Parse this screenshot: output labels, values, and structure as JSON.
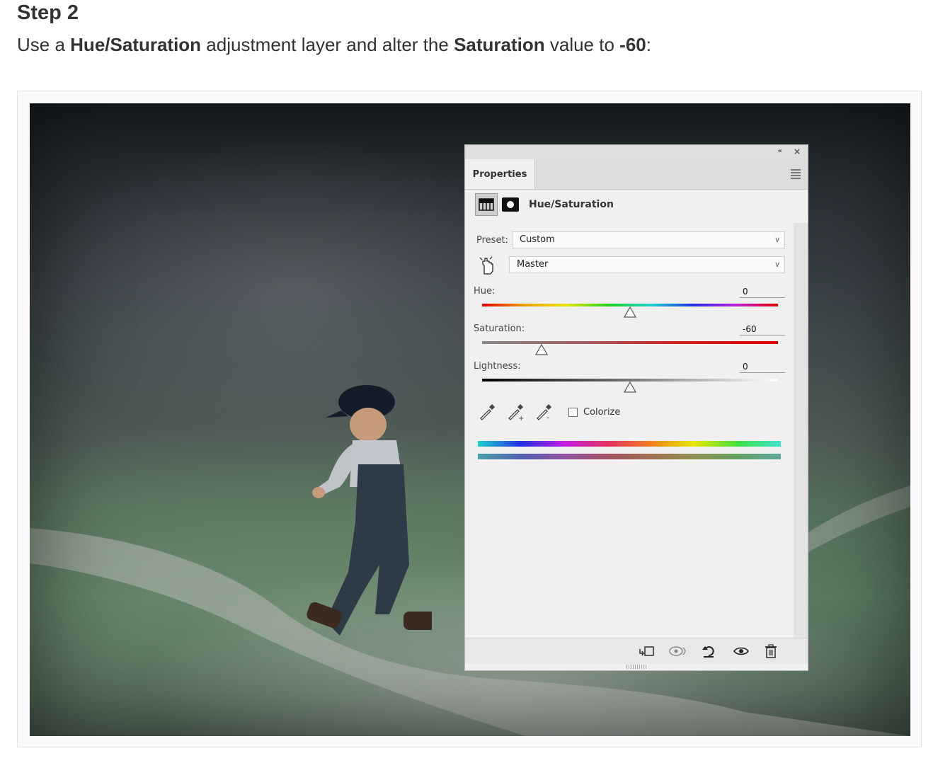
{
  "article": {
    "heading": "Step 2",
    "lead_pre": "Use a ",
    "lead_b1": "Hue/Saturation",
    "lead_mid1": " adjustment layer and alter the ",
    "lead_b2": "Saturation",
    "lead_mid2": " value to ",
    "lead_b3": "-60",
    "lead_end": ":"
  },
  "panel": {
    "collapse_glyph": "«",
    "close_glyph": "×",
    "tab": "Properties",
    "adjustment_title": "Hue/Saturation",
    "preset_label": "Preset:",
    "preset_value": "Custom",
    "channel_value": "Master",
    "hue": {
      "label": "Hue:",
      "value": "0",
      "level": 0.5
    },
    "saturation": {
      "label": "Saturation:",
      "value": "-60",
      "level": 0.2
    },
    "lightness": {
      "label": "Lightness:",
      "value": "0",
      "level": 0.5
    },
    "colorize_label": "Colorize",
    "colorize_checked": false
  },
  "icons": {
    "adjustment": "hue-saturation-icon",
    "mask": "layer-mask-icon",
    "targeted_adjust": "targeted-adjustment-hand-icon",
    "eyedroppers": [
      "eyedropper-icon",
      "eyedropper-add-icon",
      "eyedropper-subtract-icon"
    ],
    "footer": [
      "clip-to-layer-icon",
      "view-previous-state-icon",
      "reset-icon",
      "visibility-eye-icon",
      "delete-trash-icon"
    ]
  }
}
